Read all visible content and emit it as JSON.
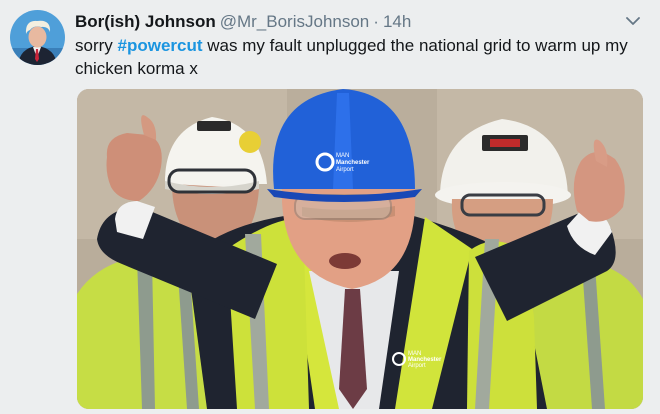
{
  "tweet": {
    "display_name": "Bor(ish) Johnson",
    "handle": "@Mr_BorisJohnson",
    "separator": "·",
    "time": "14h",
    "text_before": "sorry ",
    "hashtag": "#powercut",
    "text_after": " was my fault unplugged the national grid to warm up my chicken korma x",
    "menu_icon": "chevron-down-icon"
  },
  "photo": {
    "helmet_logo_line1": "MAN",
    "helmet_logo_line2": "Manchester",
    "helmet_logo_line3": "Airport",
    "vest_logo_line1": "MAN",
    "vest_logo_line2": "Manchester",
    "vest_logo_line3": "Airport"
  },
  "colors": {
    "hashtag": "#1b95e0",
    "name": "#14171a",
    "secondary": "#657786",
    "hi_vis": "#c9e33a",
    "helmet_blue": "#1f5fd6"
  }
}
